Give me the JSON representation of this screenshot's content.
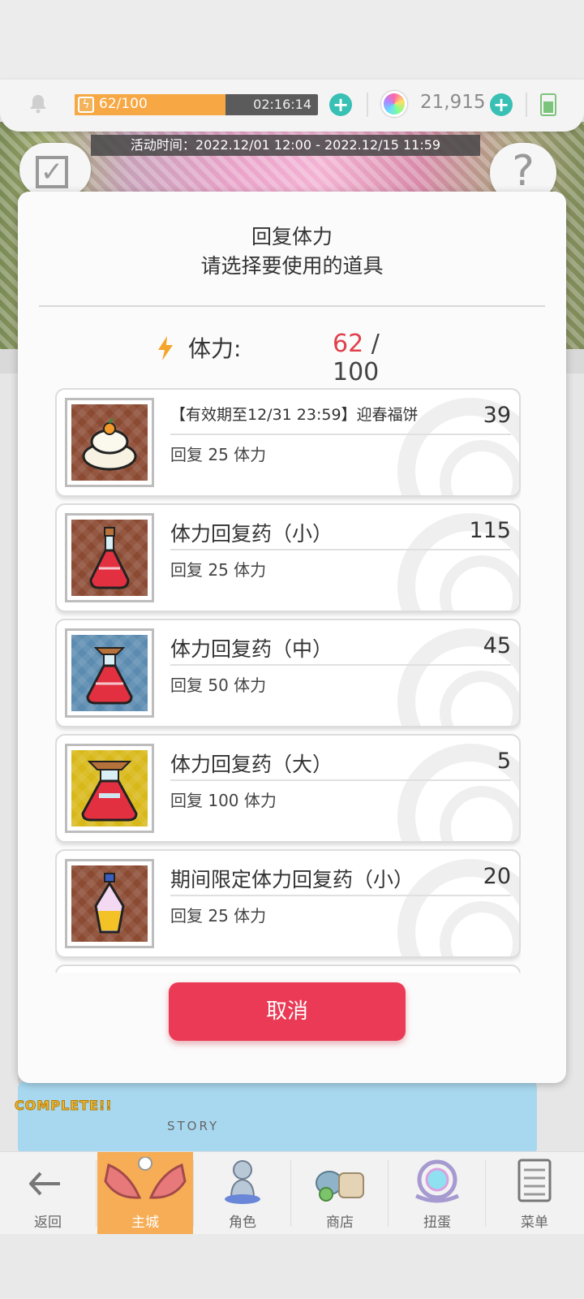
{
  "status_bar": {
    "stamina_text": "62/100",
    "stamina_fraction": 0.62,
    "timer": "02:16:14",
    "gem_count": "21,915"
  },
  "event_banner": "活动时间：2022.12/01 12:00 - 2022.12/15 11:59",
  "dialog": {
    "title": "回复体力",
    "subtitle": "请选择要使用的道具",
    "stamina_label": "体力:",
    "stamina_current": "62",
    "stamina_separator": "/",
    "stamina_max": "100",
    "cancel_label": "取消"
  },
  "items": [
    {
      "name": "【有效期至12/31 23:59】迎春福饼",
      "count": "39",
      "desc": "回复 25 体力",
      "bg": "#8b4a32",
      "icon": "mochi-icon"
    },
    {
      "name": "体力回复药（小）",
      "count": "115",
      "desc": "回复 25 体力",
      "bg": "#8b4a32",
      "icon": "potion-small-icon"
    },
    {
      "name": "体力回复药（中）",
      "count": "45",
      "desc": "回复 50 体力",
      "bg": "#5b8bb0",
      "icon": "potion-medium-icon"
    },
    {
      "name": "体力回复药（大）",
      "count": "5",
      "desc": "回复 100 体力",
      "bg": "#d8b818",
      "icon": "potion-large-icon"
    },
    {
      "name": "期间限定体力回复药（小）",
      "count": "20",
      "desc": "回复 25 体力",
      "bg": "#8b4a32",
      "icon": "limited-potion-icon"
    }
  ],
  "bottom_text": {
    "complete": "COMPLETE!!",
    "story": "STORY"
  },
  "nav": [
    {
      "label": "返回",
      "icon": "back-arrow-icon"
    },
    {
      "label": "主城",
      "icon": "home-wings-icon"
    },
    {
      "label": "角色",
      "icon": "character-icon"
    },
    {
      "label": "商店",
      "icon": "shop-icon"
    },
    {
      "label": "扭蛋",
      "icon": "gacha-icon"
    },
    {
      "label": "菜单",
      "icon": "menu-icon"
    }
  ],
  "colors": {
    "accent_red": "#ea3a55",
    "stamina_orange": "#f7a844",
    "plus_teal": "#39c0b5",
    "nav_active": "#f6ad55"
  }
}
